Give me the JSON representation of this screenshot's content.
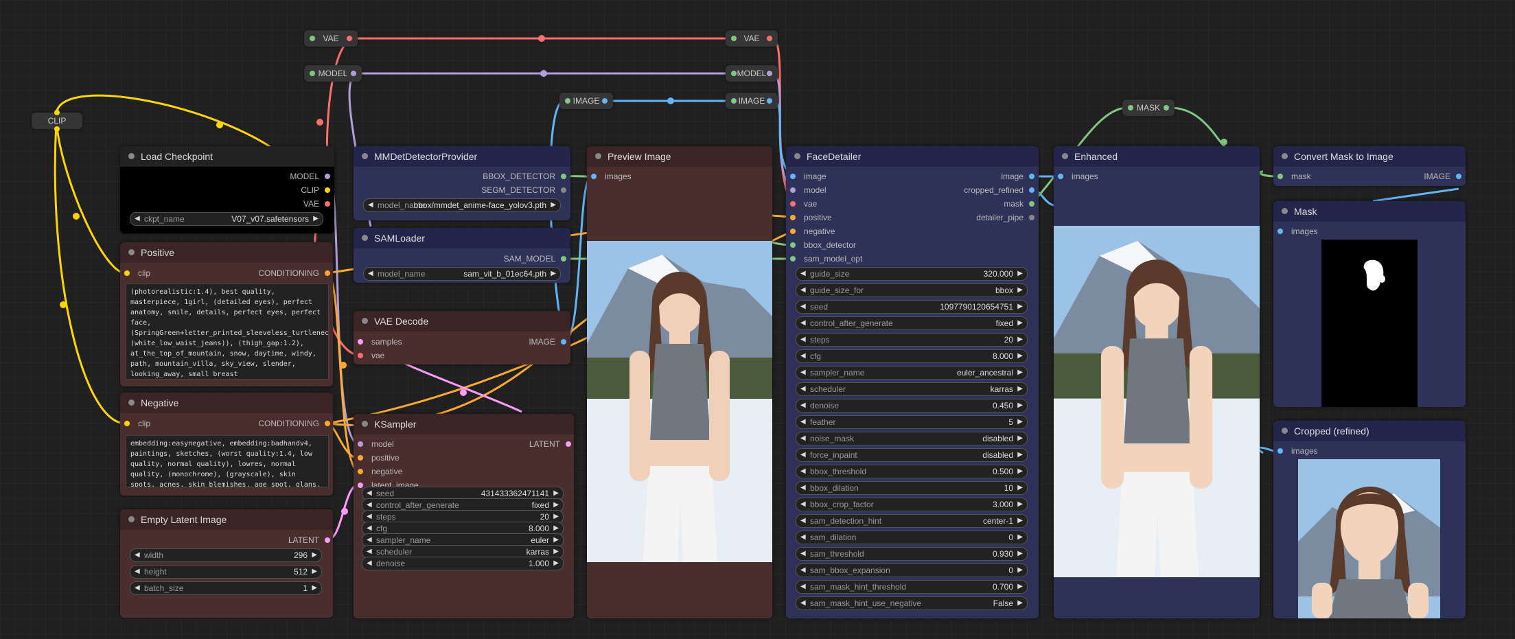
{
  "reroutes": {
    "clip": "CLIP",
    "vae1": "VAE",
    "vae2": "VAE",
    "model1": "MODEL",
    "model2": "MODEL",
    "image1": "IMAGE",
    "image2": "IMAGE",
    "mask": "MASK"
  },
  "load_checkpoint": {
    "title": "Load Checkpoint",
    "outputs": [
      "MODEL",
      "CLIP",
      "VAE"
    ],
    "widget": {
      "label": "ckpt_name",
      "value": "V07_v07.safetensors"
    }
  },
  "positive": {
    "title": "Positive",
    "input": "clip",
    "output": "CONDITIONING",
    "text": "(photorealistic:1.4), best quality, masterpiece, 1girl, (detailed eyes), perfect anatomy, smile, details, perfect eyes, perfect face, (SpringGreen+letter_printed_sleeveless_turtleneck), (white_low_waist_jeans)), (thigh_gap:1.2), at_the_top_of_mountain, snow, daytime, windy, path, mountain_villa, sky_view, slender, looking_away, small breast"
  },
  "negative": {
    "title": "Negative",
    "input": "clip",
    "output": "CONDITIONING",
    "text": "embedding:easynegative, embedding:badhandv4, paintings, sketches, (worst quality:1.4, low quality, normal quality), lowres, normal quality, (monochrome), (grayscale), skin spots, acnes, skin blemishes, age spot, glans, nsfw, watermark, signature, text, bikini,"
  },
  "empty_latent": {
    "title": "Empty Latent Image",
    "output": "LATENT",
    "widgets": [
      {
        "label": "width",
        "value": "296"
      },
      {
        "label": "height",
        "value": "512"
      },
      {
        "label": "batch_size",
        "value": "1"
      }
    ]
  },
  "mmdet": {
    "title": "MMDetDetectorProvider",
    "outputs": [
      "BBOX_DETECTOR",
      "SEGM_DETECTOR"
    ],
    "widget": {
      "label": "model_name",
      "value": "bbox/mmdet_anime-face_yolov3.pth"
    }
  },
  "samloader": {
    "title": "SAMLoader",
    "output": "SAM_MODEL",
    "widget": {
      "label": "model_name",
      "value": "sam_vit_b_01ec64.pth"
    }
  },
  "vae_decode": {
    "title": "VAE Decode",
    "inputs": [
      "samples",
      "vae"
    ],
    "output": "IMAGE"
  },
  "ksampler": {
    "title": "KSampler",
    "inputs": [
      "model",
      "positive",
      "negative",
      "latent_image"
    ],
    "output": "LATENT",
    "widgets": [
      {
        "label": "seed",
        "value": "431433362471141"
      },
      {
        "label": "control_after_generate",
        "value": "fixed"
      },
      {
        "label": "steps",
        "value": "20"
      },
      {
        "label": "cfg",
        "value": "8.000"
      },
      {
        "label": "sampler_name",
        "value": "euler"
      },
      {
        "label": "scheduler",
        "value": "karras"
      },
      {
        "label": "denoise",
        "value": "1.000"
      }
    ]
  },
  "preview": {
    "title": "Preview Image",
    "input": "images"
  },
  "facedetailer": {
    "title": "FaceDetailer",
    "inputs": [
      "image",
      "model",
      "vae",
      "positive",
      "negative",
      "bbox_detector",
      "sam_model_opt"
    ],
    "outputs": [
      "image",
      "cropped_refined",
      "mask",
      "detailer_pipe"
    ],
    "widgets": [
      {
        "label": "guide_size",
        "value": "320.000"
      },
      {
        "label": "guide_size_for",
        "value": "bbox"
      },
      {
        "label": "seed",
        "value": "1097790120654751"
      },
      {
        "label": "control_after_generate",
        "value": "fixed"
      },
      {
        "label": "steps",
        "value": "20"
      },
      {
        "label": "cfg",
        "value": "8.000"
      },
      {
        "label": "sampler_name",
        "value": "euler_ancestral"
      },
      {
        "label": "scheduler",
        "value": "karras"
      },
      {
        "label": "denoise",
        "value": "0.450"
      },
      {
        "label": "feather",
        "value": "5"
      },
      {
        "label": "noise_mask",
        "value": "disabled"
      },
      {
        "label": "force_inpaint",
        "value": "disabled"
      },
      {
        "label": "bbox_threshold",
        "value": "0.500"
      },
      {
        "label": "bbox_dilation",
        "value": "10"
      },
      {
        "label": "bbox_crop_factor",
        "value": "3.000"
      },
      {
        "label": "sam_detection_hint",
        "value": "center-1"
      },
      {
        "label": "sam_dilation",
        "value": "0"
      },
      {
        "label": "sam_threshold",
        "value": "0.930"
      },
      {
        "label": "sam_bbox_expansion",
        "value": "0"
      },
      {
        "label": "sam_mask_hint_threshold",
        "value": "0.700"
      },
      {
        "label": "sam_mask_hint_use_negative",
        "value": "False"
      }
    ]
  },
  "enhanced": {
    "title": "Enhanced",
    "input": "images"
  },
  "convert_mask": {
    "title": "Convert Mask to Image",
    "input": "mask",
    "output": "IMAGE"
  },
  "mask_preview": {
    "title": "Mask",
    "input": "images"
  },
  "cropped": {
    "title": "Cropped (refined)",
    "input": "images"
  },
  "colors": {
    "clip": "#ffd500",
    "vae": "#ff6e6e",
    "model": "#b39ddb",
    "image": "#64b5f6",
    "mask": "#81c784",
    "conditioning": "#ffa931",
    "latent": "#ff9cf9"
  }
}
